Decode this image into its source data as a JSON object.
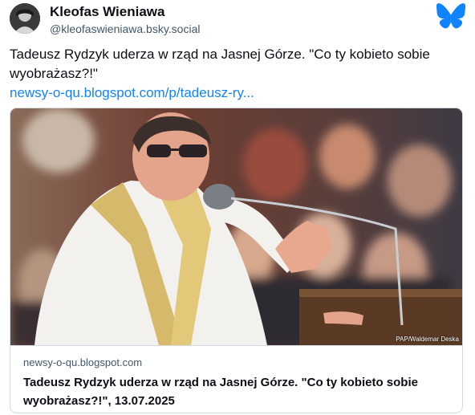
{
  "author": {
    "display_name": "Kleofas Wieniawa",
    "handle": "@kleofaswieniawa.bsky.social",
    "avatar_icon": "avatar-photo"
  },
  "post": {
    "text": "Tadeusz Rydzyk uderza w rząd na Jasnej Górze. \"Co ty kobieto sobie wyobrażasz?!\"",
    "link": "newsy-o-qu.blogspot.com/p/tadeusz-ry..."
  },
  "embed": {
    "image_credit": "PAP/Waldemar Deska",
    "domain": "newsy-o-qu.blogspot.com",
    "title": "Tadeusz Rydzyk uderza w rząd na Jasnej Górze. \"Co ty kobieto sobie wyobrażasz?!\", 13.07.2025"
  },
  "brand": {
    "logo_icon": "bluesky-butterfly-icon",
    "accent": "#1083fe"
  }
}
